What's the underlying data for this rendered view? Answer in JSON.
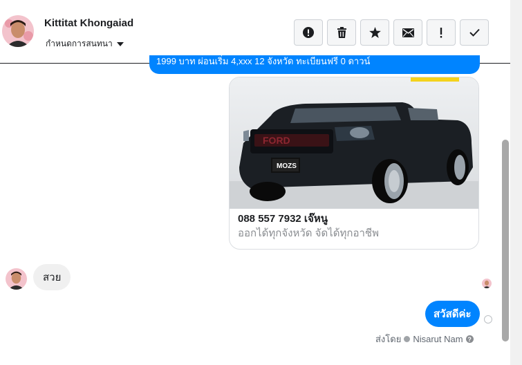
{
  "header": {
    "contact_name": "Kittitat Khongaiad",
    "conversation_settings": "กำหนดการสนทนา",
    "actions": [
      {
        "name": "spam",
        "icon": "exclamation-circle-icon"
      },
      {
        "name": "delete",
        "icon": "trash-icon"
      },
      {
        "name": "star",
        "icon": "star-icon"
      },
      {
        "name": "mark-unread",
        "icon": "envelope-icon"
      },
      {
        "name": "follow-up",
        "icon": "exclamation-icon"
      },
      {
        "name": "done",
        "icon": "checkmark-icon"
      }
    ]
  },
  "messages": {
    "partial_top": "1999 บาท ผ่อนเริ่ม 4,xxx 12 จังหวัด ทะเบียนฟรี 0 ดาวน์",
    "card": {
      "plate": "MOZS",
      "title": "088 557 7932 เจ๊หนู",
      "subtitle": "ออกได้ทุกจังหวัด จัดได้ทุกอาชีพ"
    },
    "incoming": "สวย",
    "outgoing": "สวัสดีค่ะ",
    "sent_by_prefix": "ส่งโดย",
    "sent_by_name": "Nisarut Nam",
    "help_glyph": "?"
  },
  "colors": {
    "accent": "#0084ff",
    "incoming_bg": "#f0f0f0"
  }
}
